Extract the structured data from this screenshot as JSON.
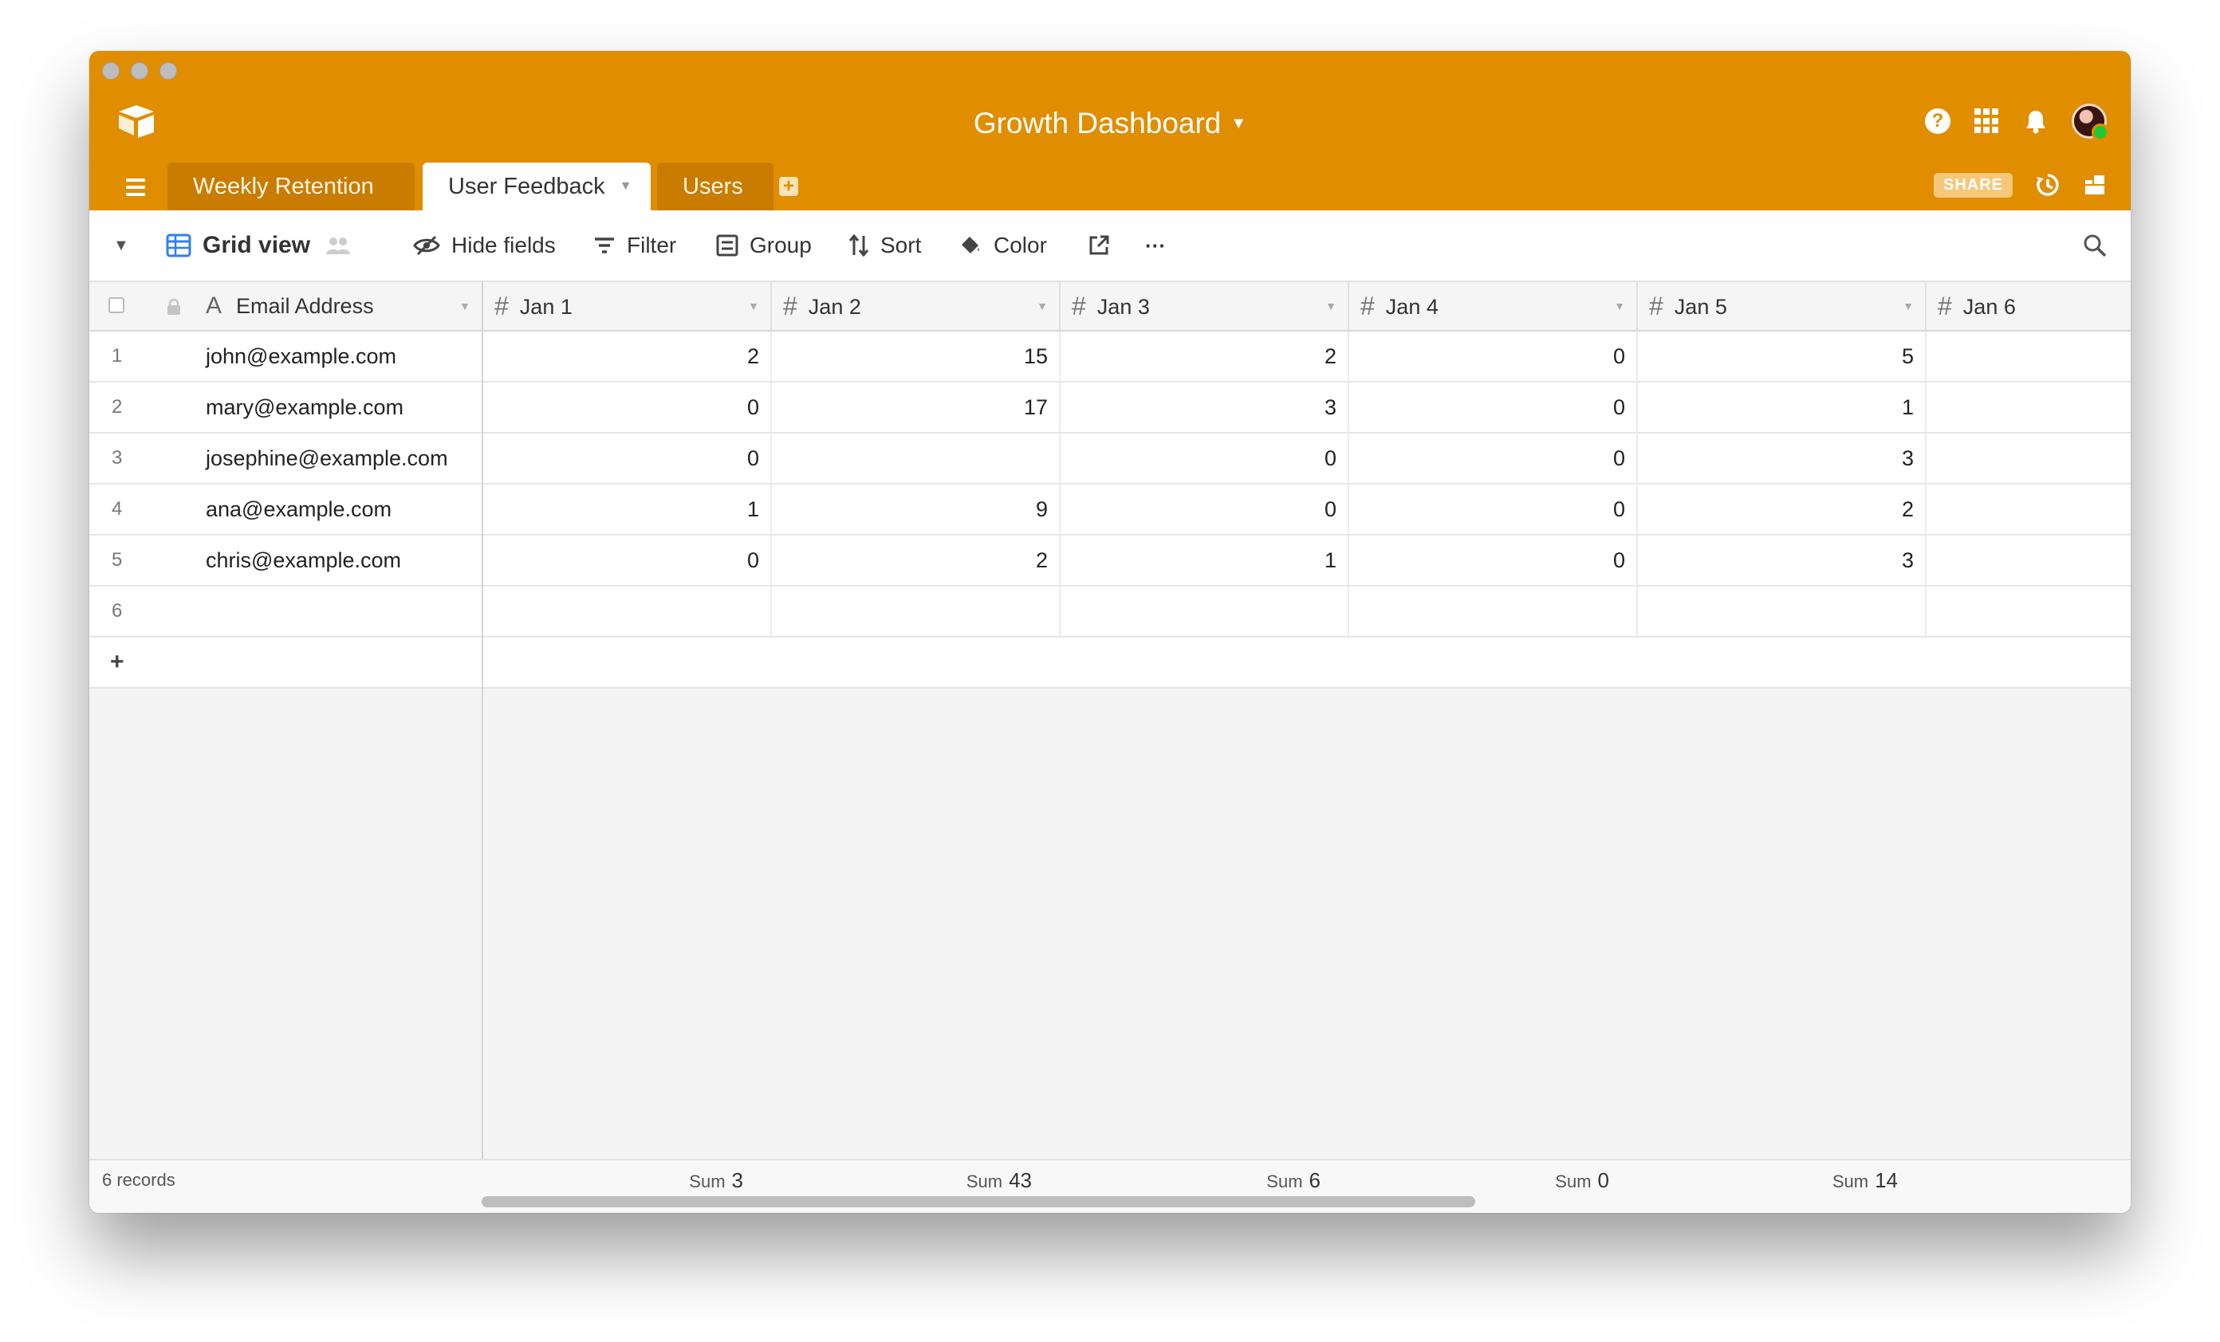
{
  "app": {
    "base_title": "Growth Dashboard",
    "brand_color": "#e08d00"
  },
  "tabs": [
    {
      "label": "Weekly Retention",
      "active": false
    },
    {
      "label": "User Feedback",
      "active": true
    },
    {
      "label": "Users",
      "active": false
    }
  ],
  "header_right": {
    "share_label": "SHARE",
    "icons": [
      "help-icon",
      "apps-icon",
      "bell-icon",
      "avatar",
      "history-icon",
      "blocks-icon"
    ]
  },
  "toolbar": {
    "view_name": "Grid view",
    "hide_fields": "Hide fields",
    "filter": "Filter",
    "group": "Group",
    "sort": "Sort",
    "color": "Color",
    "more": "···"
  },
  "grid": {
    "primary_field": "Email Address",
    "columns": [
      "Jan 1",
      "Jan 2",
      "Jan 3",
      "Jan 4",
      "Jan 5",
      "Jan 6"
    ],
    "rows": [
      {
        "num": "1",
        "email": "john@example.com",
        "values": [
          "2",
          "15",
          "2",
          "0",
          "5",
          ""
        ]
      },
      {
        "num": "2",
        "email": "mary@example.com",
        "values": [
          "0",
          "17",
          "3",
          "0",
          "1",
          ""
        ]
      },
      {
        "num": "3",
        "email": "josephine@example.com",
        "values": [
          "0",
          "",
          "0",
          "0",
          "3",
          ""
        ]
      },
      {
        "num": "4",
        "email": "ana@example.com",
        "values": [
          "1",
          "9",
          "0",
          "0",
          "2",
          ""
        ]
      },
      {
        "num": "5",
        "email": "chris@example.com",
        "values": [
          "0",
          "2",
          "1",
          "0",
          "3",
          ""
        ]
      },
      {
        "num": "6",
        "email": "",
        "values": [
          "",
          "",
          "",
          "",
          "",
          ""
        ]
      }
    ],
    "add_row": "+",
    "record_count": "6 records",
    "sum_label": "Sum",
    "sums": [
      "3",
      "43",
      "6",
      "0",
      "14"
    ]
  }
}
